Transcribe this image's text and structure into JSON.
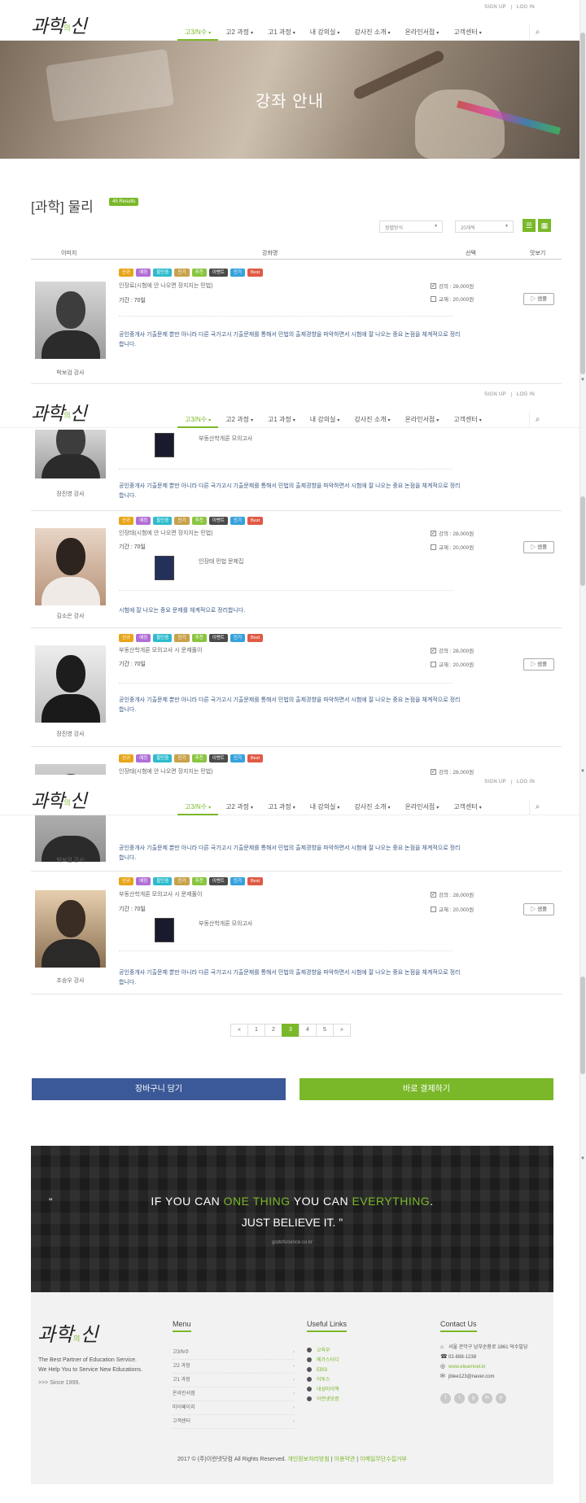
{
  "header": {
    "logo_text": "과학",
    "logo_small": "의",
    "logo_text2": "신",
    "signup": "SIGN UP",
    "login": "LOG IN",
    "nav": [
      {
        "label": "고3/N수"
      },
      {
        "label": "고2 과정"
      },
      {
        "label": "고1 과정"
      },
      {
        "label": "내 강의실"
      },
      {
        "label": "강사진 소개"
      },
      {
        "label": "온라인서점"
      },
      {
        "label": "고객센터"
      }
    ]
  },
  "hero": {
    "title": "강좌 안내"
  },
  "page": {
    "title": "[과학] 물리",
    "results": "45 Results",
    "sort_label": "정렬방식",
    "count_label": "20개씩"
  },
  "table": {
    "col_image": "이미지",
    "col_course": "강좌명",
    "col_select": "선택",
    "col_view": "맛보기"
  },
  "tags": [
    "신규",
    "예정",
    "할인중",
    "인기",
    "추천",
    "이벤트",
    "인기",
    "Best"
  ],
  "rows": [
    {
      "teacher": "박보검 강사",
      "title": "인장료(시험에 안 나오면 장지지는 민법)",
      "period": "기간 : 70일",
      "book": "",
      "desc": "공인중개사 기출문제 뿐만 아니라 다른 국가고시 기출문제를 통해서 민법의 출제경향을 파악하면서 시험에 잘 나오는 중요 논점을 체계적으로 정리합니다.",
      "lecture": "강의 : 28,000원",
      "textbook": "교재 : 20,000원",
      "detail": "▷ 샘플"
    },
    {
      "teacher": "장진영 강사",
      "title": "",
      "period": "",
      "book": "부동산학개론 모의고사",
      "desc": "공인중개사 기출문제 뿐만 아니라 다른 국가고시 기출문제를 통해서 민법의 출제경향을 파악하면서 시험에 잘 나오는 중요 논점을 체계적으로 정리합니다.",
      "lecture": "",
      "textbook": "",
      "detail": ""
    },
    {
      "teacher": "김소은 강사",
      "title": "인장태(시험에 안 나오면 장지지는 민법)",
      "period": "기간 : 70일",
      "book": "인장태 민법 문제집",
      "desc": "시험에 잘 나오는 중요 문제를 체계적으로 정리합니다.",
      "lecture": "강의 : 28,000원",
      "textbook": "교재 : 20,000원",
      "detail": "▷ 샘플"
    },
    {
      "teacher": "장진영 강사",
      "title": "부동산학개론 모의고사 시 문제풀이",
      "period": "기간 : 70일",
      "book": "",
      "desc": "공인중개사 기출문제 뿐만 아니라 다른 국가고시 기출문제를 통해서 민법의 출제경향을 파악하면서 시험에 잘 나오는 중요 논점을 체계적으로 정리합니다.",
      "lecture": "강의 : 28,000원",
      "textbook": "교재 : 20,000원",
      "detail": "▷ 샘플"
    },
    {
      "teacher": "박보검 강사",
      "title": "인장태(시험에 안 나오면 장지지는 민법)",
      "period": "",
      "book": "",
      "desc": "공인중개사 기출문제 뿐만 아니라 다른 국가고시 기출문제를 통해서 민법의 출제경향을 파악하면서 시험에 잘 나오는 중요 논점을 체계적으로 정리합니다.",
      "lecture": "강의 : 28,000원",
      "textbook": "",
      "detail": ""
    },
    {
      "teacher": "조승우 강사",
      "title": "부동산학개론 모의고사 시 문제풀이",
      "period": "기간 : 70일",
      "book": "부동산학개론 모의고사",
      "desc": "공인중개사 기출문제 뿐만 아니라 다른 국가고시 기출문제를 통해서 민법의 출제경향을 파악하면서 시험에 잘 나오는 중요 논점을 체계적으로 정리합니다.",
      "lecture": "강의 : 28,000원",
      "textbook": "교재 : 20,000원",
      "detail": "▷ 샘플"
    }
  ],
  "pagination": [
    "«",
    "1",
    "2",
    "3",
    "4",
    "5",
    "»"
  ],
  "buttons": {
    "cart": "장바구니 담기",
    "pay": "바로 결제하기"
  },
  "quote": {
    "open": "\"",
    "p1": "IF YOU CAN ",
    "p2": "ONE THING",
    "p3": " YOU CAN ",
    "p4": "EVERYTHING",
    "p5": ".",
    "line2": "JUST BELIEVE IT. \"",
    "site": "godofscience.co.kr"
  },
  "footer": {
    "tagline1": "The Best Partner of Education Service.",
    "tagline2": "We Help You to Service New Educations.",
    "since": ">>> Since 1999.",
    "menu_title": "Menu",
    "menu": [
      "고3/N수",
      "고2 과정",
      "고1 과정",
      "온라인서점",
      "마이페이지",
      "고객센터"
    ],
    "links_title": "Useful Links",
    "links": [
      "교육부",
      "메가스터디",
      "EBSi",
      "이투스",
      "대성마이맥",
      "이런넷닷컴"
    ],
    "contact_title": "Contact Us",
    "address": "서울 관악구 남부순환로 1861 덕수빌딩",
    "phone": "02-888-1238",
    "website": "www.elearnnet.kr",
    "email": "jblee123@naver.com",
    "copy1": "2017 © (주)이런넷닷컴 All Rights Reserved.",
    "copy2": "개인정보처리방침",
    "copy3": "이용약관",
    "copy4": "이메일무단수집거부"
  },
  "colors": {
    "accent": "#7ab829",
    "cart_btn": "#3b5998"
  }
}
